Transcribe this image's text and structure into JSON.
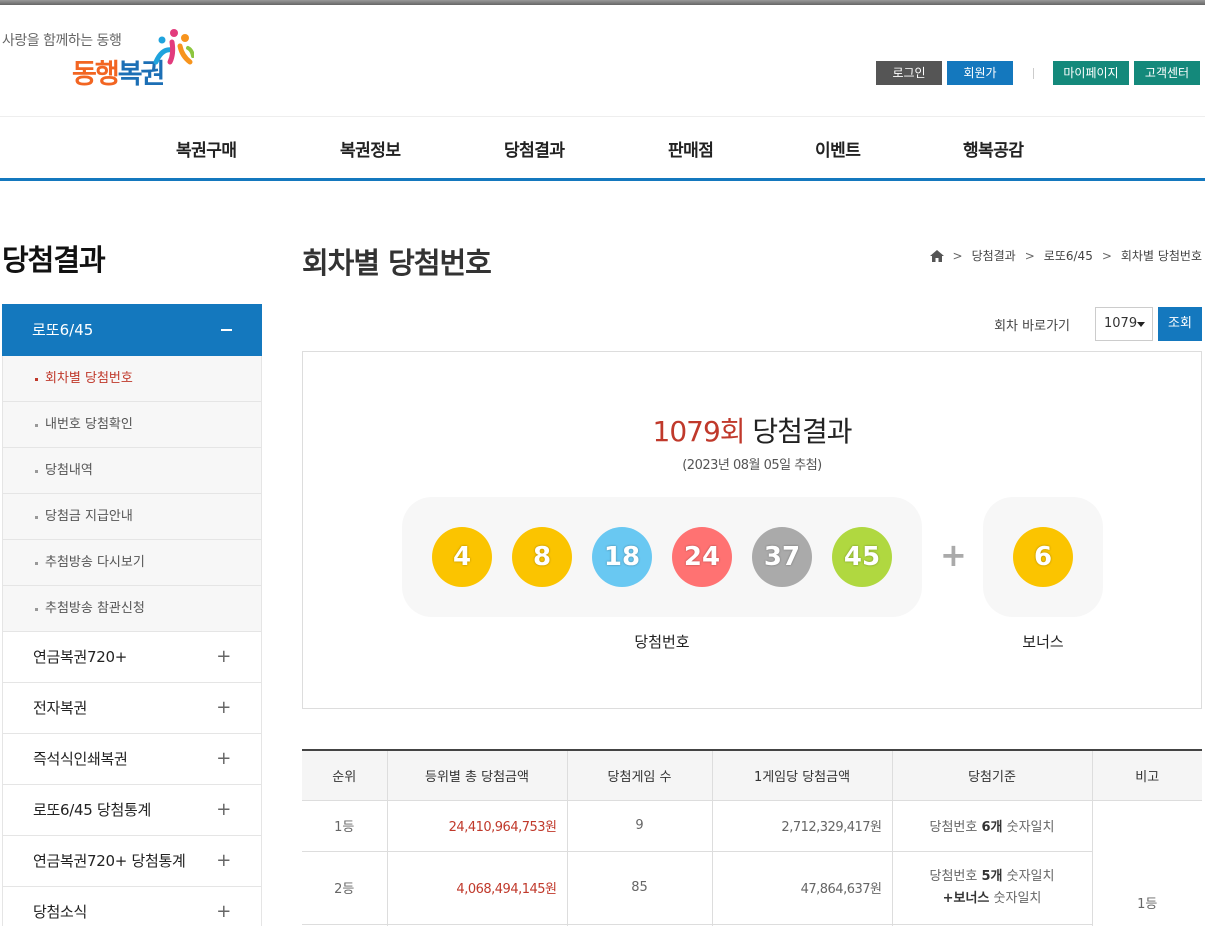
{
  "logo": {
    "slogan": "사랑을 함께하는 동행",
    "brand_a": "동행",
    "brand_b": "복권"
  },
  "util": {
    "login": "로그인",
    "join": "회원가입",
    "mypage": "마이페이지",
    "cs": "고객센터"
  },
  "gnb": [
    "복권구매",
    "복권정보",
    "당첨결과",
    "판매점",
    "이벤트",
    "행복공감"
  ],
  "lnb": {
    "title": "당첨결과",
    "active": "로또6/45",
    "sub": [
      "회차별 당첨번호",
      "내번호 당첨확인",
      "당첨내역",
      "당첨금 지급안내",
      "추첨방송 다시보기",
      "추첨방송 참관신청"
    ],
    "menus": [
      "연금복권720+",
      "전자복권",
      "즉석식인쇄복권",
      "로또6/45 당첨통계",
      "연금복권720+ 당첨통계",
      "당첨소식"
    ]
  },
  "content": {
    "title": "회차별 당첨번호",
    "breadcrumb": [
      "당첨결과",
      "로또6/45",
      "회차별 당첨번호"
    ],
    "round_label": "회차 바로가기",
    "round_value": "1079",
    "search": "조회"
  },
  "result": {
    "round_num": "1079회",
    "round_text": " 당첨결과",
    "date": "(2023년 08월 05일 추첨)",
    "numbers": [
      {
        "n": "4",
        "color": "#fbc400"
      },
      {
        "n": "8",
        "color": "#fbc400"
      },
      {
        "n": "18",
        "color": "#69c8f2"
      },
      {
        "n": "24",
        "color": "#ff7272"
      },
      {
        "n": "37",
        "color": "#aaaaaa"
      },
      {
        "n": "45",
        "color": "#b0d840"
      }
    ],
    "plus": "+",
    "bonus": {
      "n": "6",
      "color": "#fbc400"
    },
    "win_label": "당첨번호",
    "bonus_label": "보너스"
  },
  "table": {
    "headers": [
      "순위",
      "등위별 총 당첨금액",
      "당첨게임 수",
      "1게임당 당첨금액",
      "당첨기준",
      "비고"
    ],
    "rows": [
      {
        "rank": "1등",
        "total": "24,410,964,753원",
        "games": "9",
        "per": "2,712,329,417원",
        "crit_a": "당첨번호 ",
        "crit_b": "6개",
        "crit_c": " 숫자일치"
      },
      {
        "rank": "2등",
        "total": "4,068,494,145원",
        "games": "85",
        "per": "47,864,637원",
        "crit_a": "당첨번호 ",
        "crit_b": "5개",
        "crit_c": " 숫자일치",
        "crit_d": "+",
        "crit_e": "보너스",
        "crit_f": " 숫자일치"
      }
    ],
    "note": "1등"
  }
}
